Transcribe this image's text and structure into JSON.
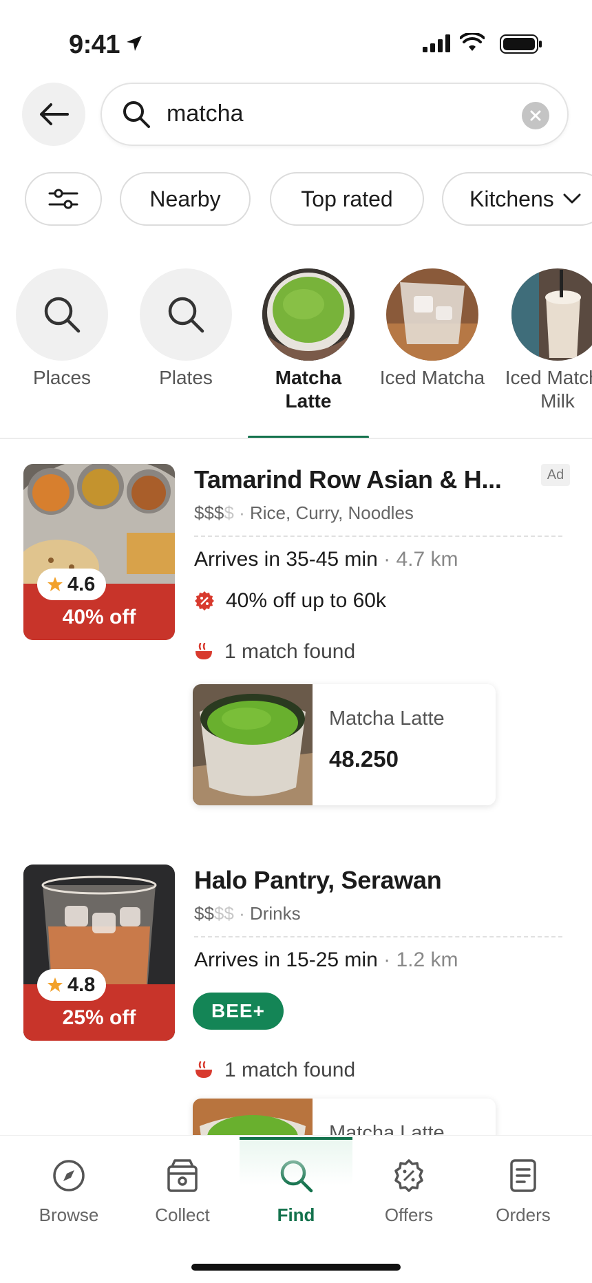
{
  "status_bar": {
    "time": "9:41"
  },
  "search": {
    "query": "matcha"
  },
  "filters": [
    {
      "label": ""
    },
    {
      "label": "Nearby"
    },
    {
      "label": "Top rated"
    },
    {
      "label": "Kitchens"
    }
  ],
  "categories": [
    {
      "label": "Places"
    },
    {
      "label": "Plates"
    },
    {
      "label": "Matcha Latte"
    },
    {
      "label": "Iced Matcha"
    },
    {
      "label": "Iced Matcha Milk"
    }
  ],
  "restaurants": [
    {
      "name": "Tamarind Row  Asian & H...",
      "ad_label": "Ad",
      "price_on": "$$$",
      "price_off": "$",
      "cuisine": "Rice, Curry, Noodles",
      "eta": "Arrives in 35-45 min",
      "distance": "4.7 km",
      "rating": "4.6",
      "promo": "40% off",
      "offer": "40% off up to 60k",
      "match": "1 match found",
      "dish": {
        "name": "Matcha Latte",
        "price": "48.250"
      }
    },
    {
      "name": "Halo Pantry, Serawan",
      "price_on": "$$",
      "price_off": "$$",
      "cuisine": "Drinks",
      "eta": "Arrives in 15-25 min",
      "distance": "1.2 km",
      "rating": "4.8",
      "promo": "25% off",
      "badge": "BEE+",
      "match": "1 match found",
      "dish": {
        "name": "Matcha Latte",
        "price": ""
      }
    }
  ],
  "nav": [
    {
      "label": "Browse",
      "icon": "compass-icon"
    },
    {
      "label": "Collect",
      "icon": "bag-icon"
    },
    {
      "label": "Find",
      "icon": "search-icon"
    },
    {
      "label": "Offers",
      "icon": "discount-icon"
    },
    {
      "label": "Orders",
      "icon": "receipt-icon"
    }
  ],
  "colors": {
    "accent": "#14724d",
    "promo": "#c8342a",
    "bee": "#148556"
  }
}
